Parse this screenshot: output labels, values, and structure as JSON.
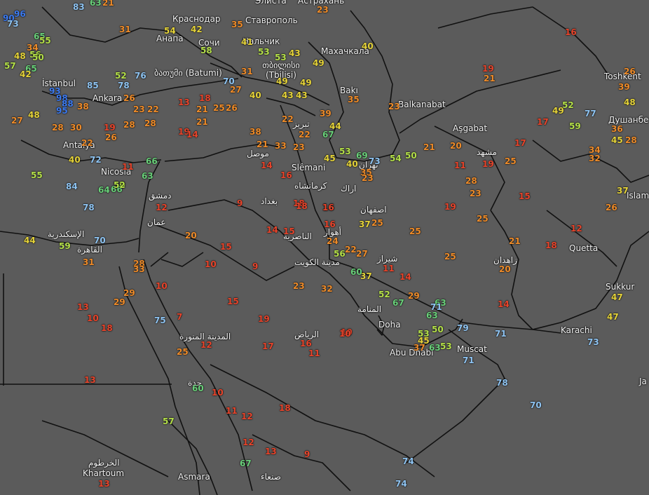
{
  "colors": {
    "background": "#5b5b5b",
    "border": "#111111",
    "red": "#e8452c",
    "orange": "#ef8c2a",
    "yellow": "#e6d43a",
    "lime": "#b5e04a",
    "green": "#6ad07a",
    "lightblue": "#8fc4f2",
    "blue": "#3d7bf0"
  },
  "cities": [
    {
      "name": "Элиста"
    },
    {
      "name": "Астрахань"
    },
    {
      "name": "Краснодар"
    },
    {
      "name": "Ставрополь"
    },
    {
      "name": "Анапа"
    },
    {
      "name": "Сочи"
    },
    {
      "name": "Нальчик"
    },
    {
      "name": "Махачкала"
    },
    {
      "name": "ბათუმი (Batumi)"
    },
    {
      "name": "თბილისი (Tbilisi)"
    },
    {
      "name": "Bakı"
    },
    {
      "name": "Balkanabat"
    },
    {
      "name": "Aşgabat"
    },
    {
      "name": "Toshkent"
    },
    {
      "name": "Душанбе"
    },
    {
      "name": "Islam"
    },
    {
      "name": "İstanbul"
    },
    {
      "name": "Ankara"
    },
    {
      "name": "Antalya"
    },
    {
      "name": "Nicosia"
    },
    {
      "name": "تبريز"
    },
    {
      "name": "موصل"
    },
    {
      "name": "Slêmani"
    },
    {
      "name": "كرمانشاه"
    },
    {
      "name": "اراك"
    },
    {
      "name": "تهران"
    },
    {
      "name": "مشهد"
    },
    {
      "name": "اصفهان"
    },
    {
      "name": "بغداد"
    },
    {
      "name": "دمشق"
    },
    {
      "name": "عمان"
    },
    {
      "name": "الإسكندرية"
    },
    {
      "name": "القاهرة"
    },
    {
      "name": "أهواز"
    },
    {
      "name": "الناصرية"
    },
    {
      "name": "مدينة الكويت"
    },
    {
      "name": "شيراز"
    },
    {
      "name": "زاهدان"
    },
    {
      "name": "Quetta"
    },
    {
      "name": "Sukkur"
    },
    {
      "name": "Karachi"
    },
    {
      "name": "المنامة"
    },
    {
      "name": "Doha"
    },
    {
      "name": "Abu Dhabi"
    },
    {
      "name": "Muscat"
    },
    {
      "name": "الرياض"
    },
    {
      "name": "المدينة المنورة"
    },
    {
      "name": "جدة"
    },
    {
      "name": "الخرطوم"
    },
    {
      "name": "Khartoum"
    },
    {
      "name": "Asmara"
    },
    {
      "name": "صنعاء"
    },
    {
      "name": "Ja"
    }
  ],
  "values": [
    {
      "v": "83",
      "c": "lightblue"
    },
    {
      "v": "63",
      "c": "green"
    },
    {
      "v": "21",
      "c": "orange"
    },
    {
      "v": "23",
      "c": "orange"
    },
    {
      "v": "31",
      "c": "orange"
    },
    {
      "v": "54",
      "c": "yellow"
    },
    {
      "v": "42",
      "c": "yellow"
    },
    {
      "v": "35",
      "c": "orange"
    },
    {
      "v": "16",
      "c": "red"
    },
    {
      "v": "41",
      "c": "yellow"
    },
    {
      "v": "58",
      "c": "lime"
    },
    {
      "v": "53",
      "c": "lime"
    },
    {
      "v": "53",
      "c": "lime"
    },
    {
      "v": "43",
      "c": "yellow"
    },
    {
      "v": "40",
      "c": "yellow"
    },
    {
      "v": "49",
      "c": "yellow"
    },
    {
      "v": "31",
      "c": "orange"
    },
    {
      "v": "52",
      "c": "lime"
    },
    {
      "v": "76",
      "c": "lightblue"
    },
    {
      "v": "78",
      "c": "lightblue"
    },
    {
      "v": "85",
      "c": "lightblue"
    },
    {
      "v": "56",
      "c": "lime"
    },
    {
      "v": "50",
      "c": "lime"
    },
    {
      "v": "65",
      "c": "green"
    },
    {
      "v": "19",
      "c": "red"
    },
    {
      "v": "21",
      "c": "orange"
    },
    {
      "v": "26",
      "c": "orange"
    },
    {
      "v": "39",
      "c": "orange"
    },
    {
      "v": "48",
      "c": "yellow"
    },
    {
      "v": "70",
      "c": "lightblue"
    },
    {
      "v": "27",
      "c": "orange"
    },
    {
      "v": "49",
      "c": "yellow"
    },
    {
      "v": "49",
      "c": "yellow"
    },
    {
      "v": "43",
      "c": "yellow"
    },
    {
      "v": "43",
      "c": "yellow"
    },
    {
      "v": "40",
      "c": "yellow"
    },
    {
      "v": "35",
      "c": "orange"
    },
    {
      "v": "23",
      "c": "orange"
    },
    {
      "v": "52",
      "c": "lime"
    },
    {
      "v": "49",
      "c": "yellow"
    },
    {
      "v": "77",
      "c": "lightblue"
    },
    {
      "v": "17",
      "c": "red"
    },
    {
      "v": "59",
      "c": "lime"
    },
    {
      "v": "36",
      "c": "orange"
    },
    {
      "v": "45",
      "c": "yellow"
    },
    {
      "v": "28",
      "c": "orange"
    },
    {
      "v": "34",
      "c": "orange"
    },
    {
      "v": "32",
      "c": "orange"
    },
    {
      "v": "37",
      "c": "yellow"
    },
    {
      "v": "26",
      "c": "orange"
    },
    {
      "v": "26",
      "c": "orange"
    },
    {
      "v": "23",
      "c": "orange"
    },
    {
      "v": "22",
      "c": "orange"
    },
    {
      "v": "13",
      "c": "red"
    },
    {
      "v": "18",
      "c": "red"
    },
    {
      "v": "25",
      "c": "orange"
    },
    {
      "v": "21",
      "c": "orange"
    },
    {
      "v": "26",
      "c": "orange"
    },
    {
      "v": "21",
      "c": "orange"
    },
    {
      "v": "28",
      "c": "orange"
    },
    {
      "v": "19",
      "c": "red"
    },
    {
      "v": "22",
      "c": "orange"
    },
    {
      "v": "38",
      "c": "orange"
    },
    {
      "v": "22",
      "c": "orange"
    },
    {
      "v": "39",
      "c": "orange"
    },
    {
      "v": "44",
      "c": "yellow"
    },
    {
      "v": "67",
      "c": "green"
    },
    {
      "v": "33",
      "c": "orange"
    },
    {
      "v": "23",
      "c": "orange"
    },
    {
      "v": "21",
      "c": "orange"
    },
    {
      "v": "14",
      "c": "red"
    },
    {
      "v": "16",
      "c": "red"
    },
    {
      "v": "18",
      "c": "red"
    },
    {
      "v": "16",
      "c": "red"
    },
    {
      "v": "15",
      "c": "red"
    },
    {
      "v": "14",
      "c": "red"
    },
    {
      "v": "53",
      "c": "lime"
    },
    {
      "v": "69",
      "c": "green"
    },
    {
      "v": "73",
      "c": "lightblue"
    },
    {
      "v": "54",
      "c": "lime"
    },
    {
      "v": "50",
      "c": "lime"
    },
    {
      "v": "21",
      "c": "orange"
    },
    {
      "v": "20",
      "c": "orange"
    },
    {
      "v": "17",
      "c": "red"
    },
    {
      "v": "45",
      "c": "yellow"
    },
    {
      "v": "40",
      "c": "yellow"
    },
    {
      "v": "35",
      "c": "orange"
    },
    {
      "v": "23",
      "c": "orange"
    },
    {
      "v": "11",
      "c": "red"
    },
    {
      "v": "19",
      "c": "red"
    },
    {
      "v": "25",
      "c": "orange"
    },
    {
      "v": "28",
      "c": "orange"
    },
    {
      "v": "23",
      "c": "orange"
    },
    {
      "v": "25",
      "c": "orange"
    },
    {
      "v": "15",
      "c": "red"
    },
    {
      "v": "9",
      "c": "red"
    },
    {
      "v": "18",
      "c": "red"
    },
    {
      "v": "16",
      "c": "red"
    },
    {
      "v": "37",
      "c": "yellow"
    },
    {
      "v": "25",
      "c": "orange"
    },
    {
      "v": "25",
      "c": "orange"
    },
    {
      "v": "19",
      "c": "red"
    },
    {
      "v": "16",
      "c": "red"
    },
    {
      "v": "24",
      "c": "orange"
    },
    {
      "v": "22",
      "c": "orange"
    },
    {
      "v": "14",
      "c": "red"
    },
    {
      "v": "21",
      "c": "orange"
    },
    {
      "v": "12",
      "c": "red"
    },
    {
      "v": "18",
      "c": "red"
    },
    {
      "v": "20",
      "c": "orange"
    },
    {
      "v": "25",
      "c": "orange"
    },
    {
      "v": "56",
      "c": "lime"
    },
    {
      "v": "27",
      "c": "orange"
    },
    {
      "v": "11",
      "c": "red"
    },
    {
      "v": "37",
      "c": "yellow"
    },
    {
      "v": "60",
      "c": "green"
    },
    {
      "v": "14",
      "c": "red"
    },
    {
      "v": "23",
      "c": "orange"
    },
    {
      "v": "32",
      "c": "orange"
    },
    {
      "v": "52",
      "c": "lime"
    },
    {
      "v": "63",
      "c": "green"
    },
    {
      "v": "67",
      "c": "green"
    },
    {
      "v": "29",
      "c": "orange"
    },
    {
      "v": "71",
      "c": "lightblue"
    },
    {
      "v": "63",
      "c": "green"
    },
    {
      "v": "14",
      "c": "red"
    },
    {
      "v": "79",
      "c": "lightblue"
    },
    {
      "v": "71",
      "c": "lightblue"
    },
    {
      "v": "10",
      "c": "red"
    },
    {
      "v": "53",
      "c": "lime"
    },
    {
      "v": "50",
      "c": "lime"
    },
    {
      "v": "45",
      "c": "yellow"
    },
    {
      "v": "37",
      "c": "orange"
    },
    {
      "v": "63",
      "c": "green"
    },
    {
      "v": "53",
      "c": "lime"
    },
    {
      "v": "71",
      "c": "lightblue"
    },
    {
      "v": "78",
      "c": "lightblue"
    },
    {
      "v": "70",
      "c": "lightblue"
    },
    {
      "v": "47",
      "c": "yellow"
    },
    {
      "v": "47",
      "c": "yellow"
    },
    {
      "v": "73",
      "c": "lightblue"
    },
    {
      "v": "44",
      "c": "yellow"
    },
    {
      "v": "59",
      "c": "lime"
    },
    {
      "v": "31",
      "c": "orange"
    },
    {
      "v": "70",
      "c": "lightblue"
    },
    {
      "v": "84",
      "c": "lightblue"
    },
    {
      "v": "78",
      "c": "lightblue"
    },
    {
      "v": "64",
      "c": "green"
    },
    {
      "v": "50",
      "c": "lime"
    },
    {
      "v": "63",
      "c": "green"
    },
    {
      "v": "55",
      "c": "lime"
    },
    {
      "v": "72",
      "c": "lightblue"
    },
    {
      "v": "66",
      "c": "green"
    },
    {
      "v": "12",
      "c": "red"
    },
    {
      "v": "20",
      "c": "orange"
    },
    {
      "v": "15",
      "c": "red"
    },
    {
      "v": "10",
      "c": "red"
    },
    {
      "v": "9",
      "c": "red"
    },
    {
      "v": "28",
      "c": "orange"
    },
    {
      "v": "33",
      "c": "orange"
    },
    {
      "v": "29",
      "c": "orange"
    },
    {
      "v": "29",
      "c": "orange"
    },
    {
      "v": "10",
      "c": "red"
    },
    {
      "v": "13",
      "c": "red"
    },
    {
      "v": "10",
      "c": "red"
    },
    {
      "v": "18",
      "c": "red"
    },
    {
      "v": "7",
      "c": "red"
    },
    {
      "v": "75",
      "c": "lightblue"
    },
    {
      "v": "15",
      "c": "red"
    },
    {
      "v": "19",
      "c": "red"
    },
    {
      "v": "17",
      "c": "red"
    },
    {
      "v": "12",
      "c": "red"
    },
    {
      "v": "25",
      "c": "orange"
    },
    {
      "v": "16",
      "c": "red"
    },
    {
      "v": "11",
      "c": "red"
    },
    {
      "v": "10",
      "c": "red"
    },
    {
      "v": "13",
      "c": "red"
    },
    {
      "v": "60",
      "c": "green"
    },
    {
      "v": "10",
      "c": "red"
    },
    {
      "v": "11",
      "c": "red"
    },
    {
      "v": "12",
      "c": "red"
    },
    {
      "v": "18",
      "c": "red"
    },
    {
      "v": "57",
      "c": "lime"
    },
    {
      "v": "12",
      "c": "red"
    },
    {
      "v": "13",
      "c": "red"
    },
    {
      "v": "9",
      "c": "red"
    },
    {
      "v": "67",
      "c": "green"
    },
    {
      "v": "74",
      "c": "lightblue"
    },
    {
      "v": "74",
      "c": "lightblue"
    },
    {
      "v": "13",
      "c": "red"
    },
    {
      "v": "93",
      "c": "blue"
    },
    {
      "v": "98",
      "c": "blue"
    },
    {
      "v": "88",
      "c": "blue"
    },
    {
      "v": "95",
      "c": "blue"
    },
    {
      "v": "90",
      "c": "blue"
    },
    {
      "v": "96",
      "c": "blue"
    },
    {
      "v": "73",
      "c": "lightblue"
    },
    {
      "v": "65",
      "c": "green"
    },
    {
      "v": "34",
      "c": "orange"
    },
    {
      "v": "48",
      "c": "yellow"
    },
    {
      "v": "57",
      "c": "lime"
    },
    {
      "v": "42",
      "c": "yellow"
    },
    {
      "v": "55",
      "c": "lime"
    },
    {
      "v": "48",
      "c": "yellow"
    },
    {
      "v": "27",
      "c": "orange"
    },
    {
      "v": "28",
      "c": "orange"
    },
    {
      "v": "30",
      "c": "orange"
    },
    {
      "v": "40",
      "c": "yellow"
    },
    {
      "v": "22",
      "c": "orange"
    },
    {
      "v": "19",
      "c": "red"
    },
    {
      "v": "28",
      "c": "orange"
    },
    {
      "v": "26",
      "c": "orange"
    },
    {
      "v": "11",
      "c": "red"
    },
    {
      "v": "66",
      "c": "green"
    },
    {
      "v": "52",
      "c": "lime"
    },
    {
      "v": "38",
      "c": "orange"
    }
  ]
}
